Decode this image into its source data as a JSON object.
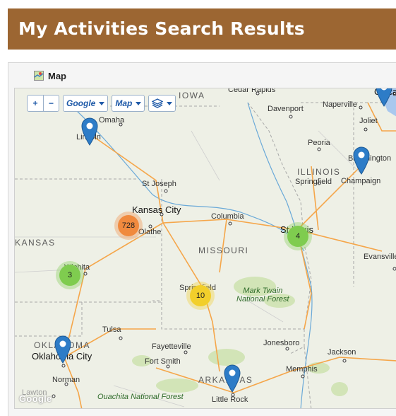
{
  "header": {
    "title": "My Activities Search Results"
  },
  "panel": {
    "title": "Map",
    "icon": "map-icon"
  },
  "map_controls": {
    "zoom_in": "+",
    "zoom_out": "−",
    "provider": "Google",
    "map_type": "Map",
    "layers_icon": "layers-icon"
  },
  "map_labels": {
    "iowa": "IOWA",
    "cedar_rapids": "Cedar Rapids",
    "chicago": "Chicago",
    "omaha": "Omaha",
    "lincoln": "Lincoln",
    "davenport": "Davenport",
    "naperville": "Naperville",
    "joliet": "Joliet",
    "peoria": "Peoria",
    "illinois": "ILLINOIS",
    "bloomington": "Bloomington",
    "champaign": "Champaign",
    "springfield_il": "Springfield",
    "st_joseph": "St Joseph",
    "kansas_city": "Kansas City",
    "olathe": "Olathe",
    "columbia": "Columbia",
    "kansas": "KANSAS",
    "missouri": "MISSOURI",
    "st_louis": "St Louis",
    "evansville": "Evansville",
    "wichita": "Wichita",
    "springfield_mo": "Springfield",
    "mark_twain": "Mark Twain\nNational Forest",
    "tulsa": "Tulsa",
    "oklahoma": "OKLAHOMA",
    "oklahoma_city": "Oklahoma City",
    "fayetteville": "Fayetteville",
    "fort_smith": "Fort Smith",
    "jonesboro": "Jonesboro",
    "jackson": "Jackson",
    "memphis": "Memphis",
    "arkansas": "ARKANSAS",
    "norman": "Norman",
    "lawton": "Lawton",
    "ouachita": "Ouachita National Forest",
    "little_rock": "Little Rock",
    "google": "Google"
  },
  "clusters": [
    {
      "id": "kansas-city",
      "count": "728",
      "color": "#f08a3e"
    },
    {
      "id": "st-louis",
      "count": "4",
      "color": "#7fcc4f"
    },
    {
      "id": "wichita",
      "count": "3",
      "color": "#7fcc4f"
    },
    {
      "id": "springfield",
      "count": "10",
      "color": "#f2cf2b"
    }
  ],
  "marker_color": "#2d7cc7"
}
